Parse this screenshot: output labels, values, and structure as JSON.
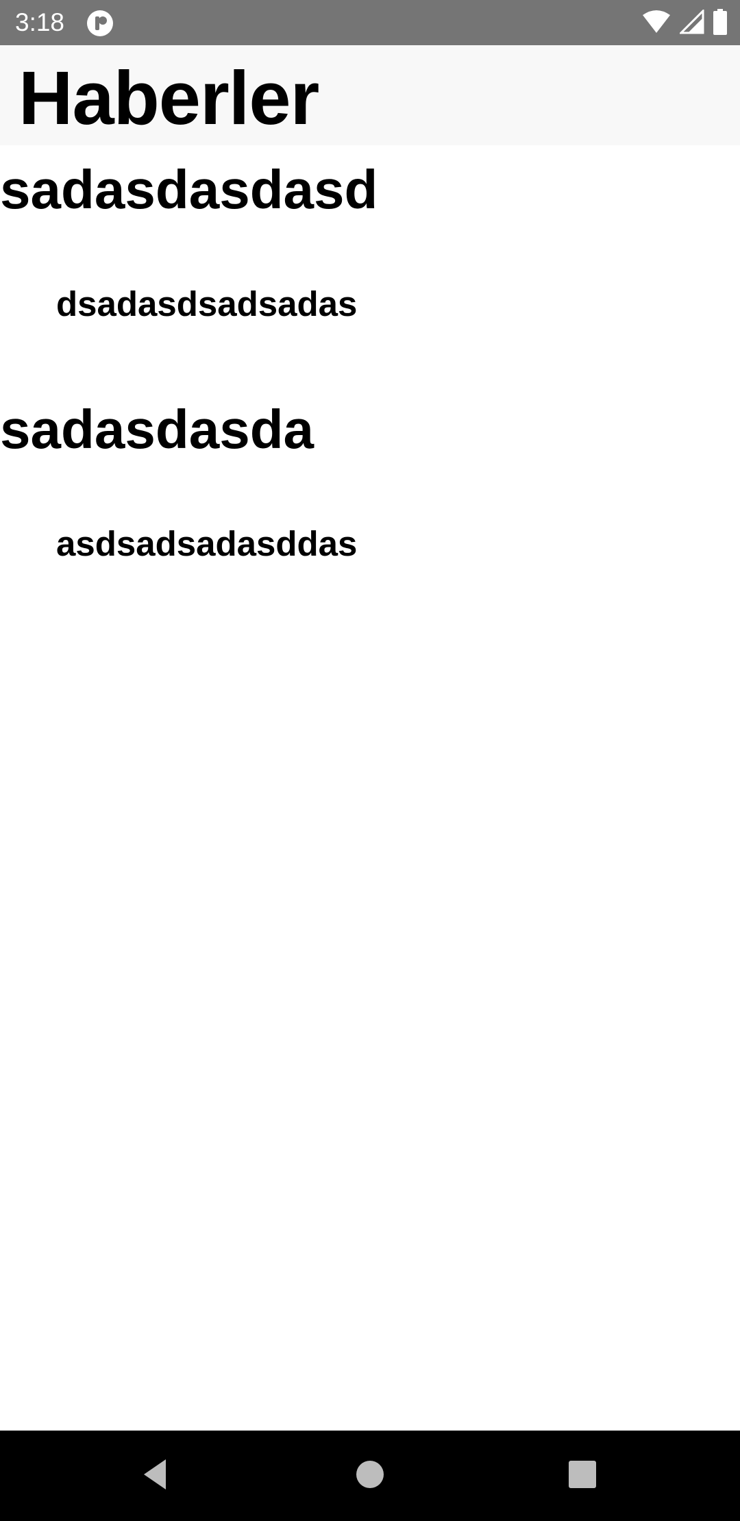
{
  "status_bar": {
    "time": "3:18",
    "app_icon": "app-notification-icon",
    "icons": [
      "wifi-icon",
      "cell-signal-icon",
      "battery-icon"
    ]
  },
  "app_bar": {
    "title": "Haberler"
  },
  "news": [
    {
      "title": "sadasdasdasd",
      "body": "dsadasdsadsadas"
    },
    {
      "title": "sadasdasda",
      "body": "asdsadsadasddas"
    }
  ],
  "nav_bar": {
    "buttons": [
      "back-icon",
      "home-icon",
      "recents-icon"
    ]
  },
  "colors": {
    "status_bar_bg": "#757575",
    "app_bar_bg": "#f8f8f8",
    "content_bg": "#ffffff",
    "nav_bar_bg": "#000000",
    "nav_icon": "#bdbdbd",
    "text": "#000000"
  }
}
